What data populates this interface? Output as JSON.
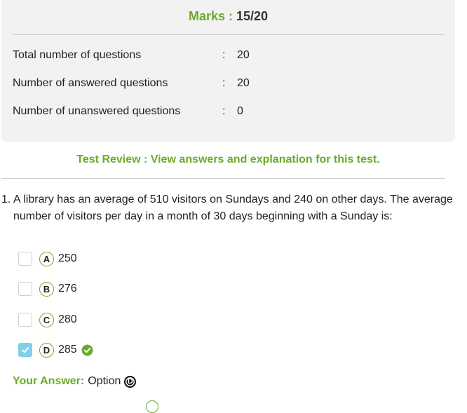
{
  "summary": {
    "marks_label": "Marks :",
    "marks_value": "15/20",
    "rows": [
      {
        "label": "Total number of questions",
        "colon": ":",
        "value": "20"
      },
      {
        "label": "Number of answered questions",
        "colon": ":",
        "value": "20"
      },
      {
        "label": "Number of unanswered questions",
        "colon": ":",
        "value": "0"
      }
    ]
  },
  "review": {
    "text": "Test Review : View answers and explanation for this test."
  },
  "question": {
    "number": "1.",
    "text": "A library has an average of 510 visitors on Sundays and 240 on other days. The average number of visitors per day in a month of 30 days beginning with a Sunday is:",
    "options": [
      {
        "letter": "A",
        "text": "250",
        "checked": false,
        "correct": false
      },
      {
        "letter": "B",
        "text": "276",
        "checked": false,
        "correct": false
      },
      {
        "letter": "C",
        "text": "280",
        "checked": false,
        "correct": false
      },
      {
        "letter": "D",
        "text": "285",
        "checked": true,
        "correct": true
      }
    ]
  },
  "your_answer": {
    "label": "Your Answer:",
    "option_word": "Option",
    "letter": "D"
  },
  "colors": {
    "accent_green": "#6aac2a",
    "checkbox_checked": "#7fd0e8"
  }
}
